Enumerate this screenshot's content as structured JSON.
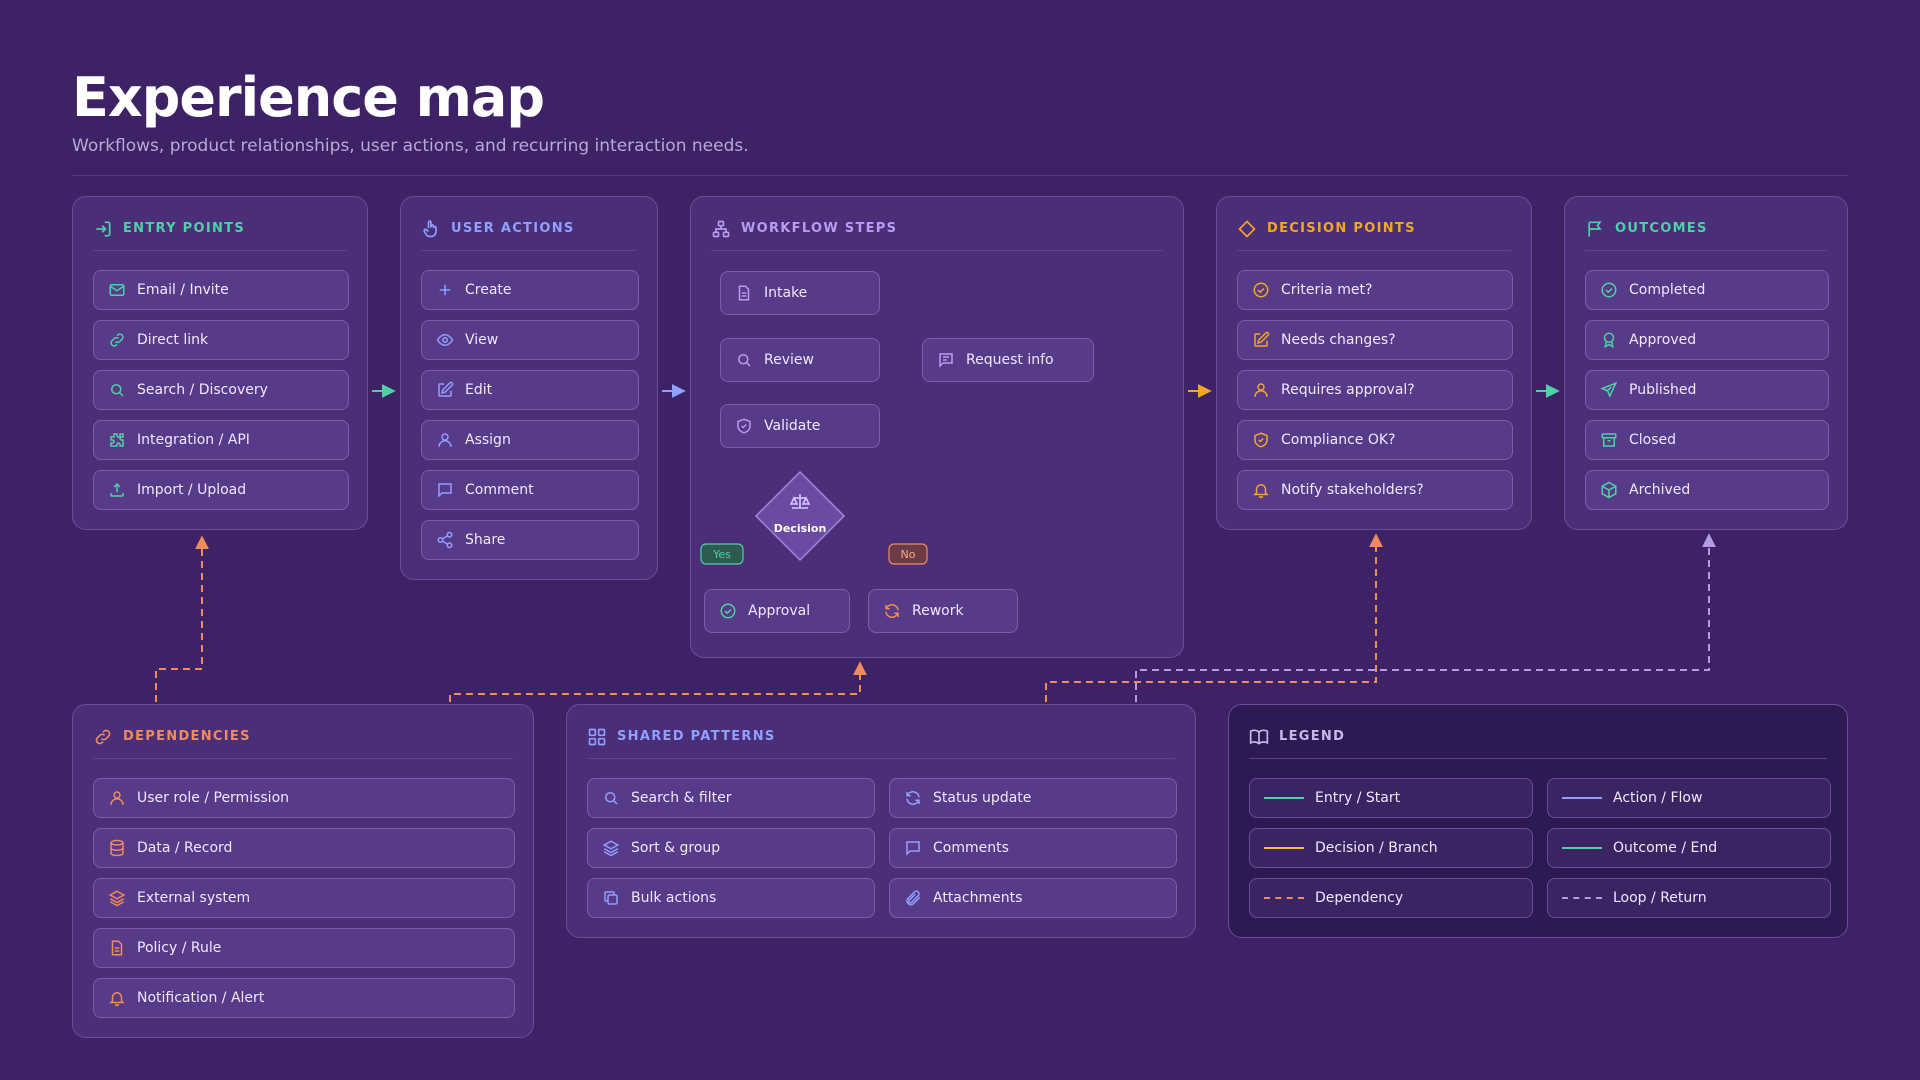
{
  "header": {
    "title": "Experience map",
    "subtitle": "Workflows, product relationships, user actions, and recurring interaction needs."
  },
  "colors": {
    "background": "#3d2366",
    "entry": "#4fd1a5",
    "action": "#8fa0ff",
    "workflow": "#b79cf2",
    "decision": "#f5a623",
    "outcome": "#4fd1a5",
    "dependency": "#f08b5b",
    "loop": "#b59ae6"
  },
  "entry_points": {
    "title": "ENTRY POINTS",
    "icon": "login-icon",
    "items": [
      {
        "label": "Email / Invite",
        "icon": "mail-icon"
      },
      {
        "label": "Direct link",
        "icon": "link-icon"
      },
      {
        "label": "Search / Discovery",
        "icon": "search-icon"
      },
      {
        "label": "Integration / API",
        "icon": "puzzle-icon"
      },
      {
        "label": "Import / Upload",
        "icon": "upload-icon"
      }
    ]
  },
  "user_actions": {
    "title": "USER ACTIONS",
    "icon": "pointer-hand-icon",
    "items": [
      {
        "label": "Create",
        "icon": "plus-icon"
      },
      {
        "label": "View",
        "icon": "eye-icon"
      },
      {
        "label": "Edit",
        "icon": "edit-icon"
      },
      {
        "label": "Assign",
        "icon": "user-icon"
      },
      {
        "label": "Comment",
        "icon": "comment-icon"
      },
      {
        "label": "Share",
        "icon": "share-icon"
      }
    ]
  },
  "workflow_steps": {
    "title": "WORKFLOW STEPS",
    "icon": "hierarchy-icon",
    "intake": "Intake",
    "review": "Review",
    "request_info": "Request info",
    "validate": "Validate",
    "decision": "Decision",
    "yes": "Yes",
    "no": "No",
    "approval": "Approval",
    "rework": "Rework"
  },
  "decision_points": {
    "title": "DECISION POINTS",
    "icon": "diamond-icon",
    "items": [
      {
        "label": "Criteria met?",
        "icon": "check-circle-icon"
      },
      {
        "label": "Needs changes?",
        "icon": "edit-icon"
      },
      {
        "label": "Requires approval?",
        "icon": "user-icon"
      },
      {
        "label": "Compliance OK?",
        "icon": "shield-icon"
      },
      {
        "label": "Notify stakeholders?",
        "icon": "bell-icon"
      }
    ]
  },
  "outcomes": {
    "title": "OUTCOMES",
    "icon": "flag-icon",
    "items": [
      {
        "label": "Completed",
        "icon": "check-circle-icon"
      },
      {
        "label": "Approved",
        "icon": "badge-icon"
      },
      {
        "label": "Published",
        "icon": "send-icon"
      },
      {
        "label": "Closed",
        "icon": "archive-box-icon"
      },
      {
        "label": "Archived",
        "icon": "package-icon"
      }
    ]
  },
  "dependencies": {
    "title": "DEPENDENCIES",
    "icon": "link-icon",
    "items": [
      {
        "label": "User role / Permission",
        "icon": "user-icon"
      },
      {
        "label": "Data / Record",
        "icon": "database-icon"
      },
      {
        "label": "External system",
        "icon": "layers-icon"
      },
      {
        "label": "Policy / Rule",
        "icon": "document-icon"
      },
      {
        "label": "Notification / Alert",
        "icon": "bell-icon"
      }
    ]
  },
  "shared_patterns": {
    "title": "SHARED PATTERNS",
    "icon": "grid-icon",
    "items": [
      {
        "label": "Search & filter",
        "icon": "search-icon"
      },
      {
        "label": "Status update",
        "icon": "refresh-icon"
      },
      {
        "label": "Sort & group",
        "icon": "layers-icon"
      },
      {
        "label": "Comments",
        "icon": "comment-icon"
      },
      {
        "label": "Bulk actions",
        "icon": "copy-icon"
      },
      {
        "label": "Attachments",
        "icon": "paperclip-icon"
      }
    ]
  },
  "legend": {
    "title": "LEGEND",
    "icon": "book-icon",
    "items": [
      {
        "label": "Entry / Start",
        "color": "#4fd1a5",
        "style": "solid"
      },
      {
        "label": "Action / Flow",
        "color": "#8fa0ff",
        "style": "solid"
      },
      {
        "label": "Decision / Branch",
        "color": "#f5b83d",
        "style": "solid"
      },
      {
        "label": "Outcome / End",
        "color": "#4fd1a5",
        "style": "solid"
      },
      {
        "label": "Dependency",
        "color": "#f08b5b",
        "style": "dashed"
      },
      {
        "label": "Loop / Return",
        "color": "#b59ae6",
        "style": "dashed"
      }
    ]
  }
}
